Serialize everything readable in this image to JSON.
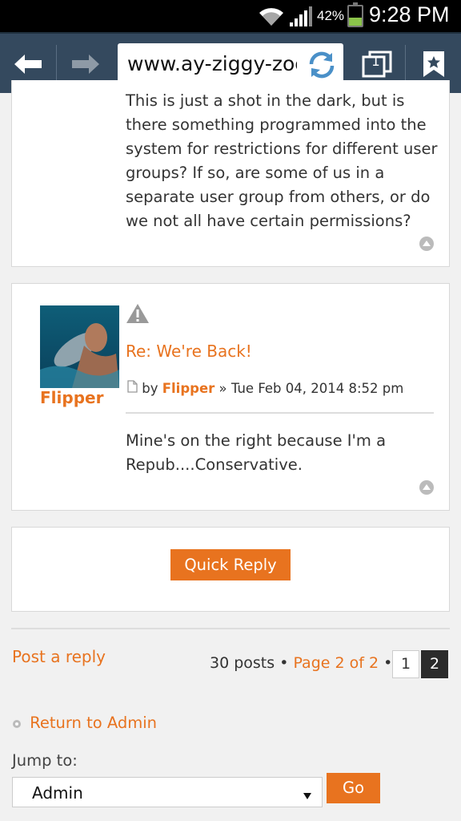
{
  "status_bar": {
    "battery": "42%",
    "time": "9:28 PM"
  },
  "browser": {
    "url": "www.ay-ziggy-zoomba.com",
    "tab_count": "1"
  },
  "post1": {
    "text": "This is just a shot in the dark, but is there something programmed into the system for restrictions for different user groups? If so, are some of us in a separate user group from others, or do we not all have certain permissions?"
  },
  "post2": {
    "author": "Flipper",
    "title": "Re: We're Back!",
    "by": "by",
    "author_link": "Flipper",
    "date": "» Tue Feb 04, 2014 8:52 pm",
    "text": "Mine's on the right because I'm a Repub....Conservative."
  },
  "quick_reply": {
    "label": "Quick Reply"
  },
  "footer": {
    "post_reply": "Post a reply",
    "posts_count": "30 posts •",
    "page_of": "Page 2 of 2",
    "bullet": "•",
    "pages": [
      "1",
      "2"
    ],
    "return_link": "Return to Admin",
    "jump_label": "Jump to:",
    "jump_value": "Admin",
    "go_label": "Go"
  },
  "colors": {
    "accent": "#e8731f",
    "toolbar": "#34495e"
  }
}
